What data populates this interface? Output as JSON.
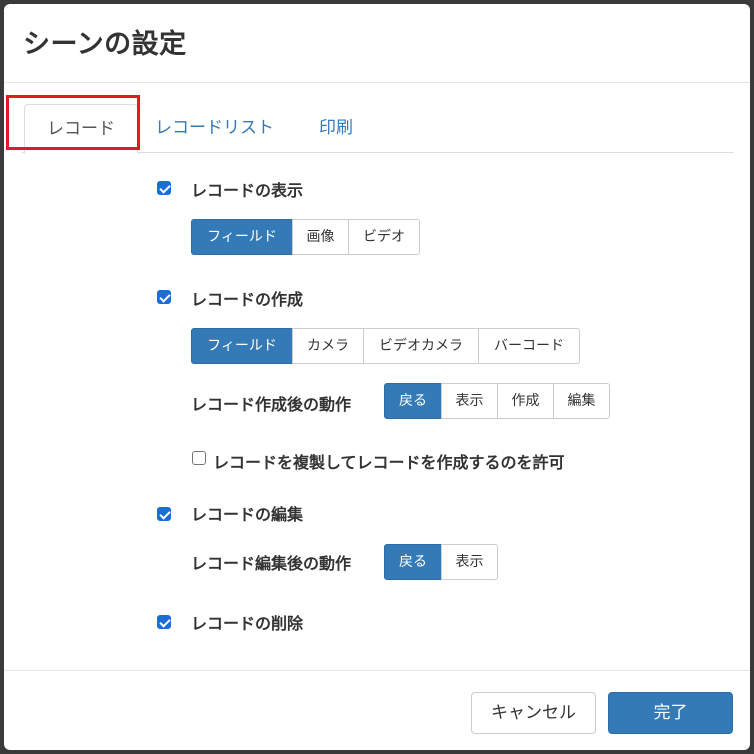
{
  "dialog": {
    "title": "シーンの設定"
  },
  "tabs": [
    {
      "label": "レコード",
      "active": true
    },
    {
      "label": "レコードリスト",
      "active": false
    },
    {
      "label": "印刷",
      "active": false
    }
  ],
  "record_display": {
    "checked": true,
    "label": "レコードの表示",
    "options": [
      "フィールド",
      "画像",
      "ビデオ"
    ],
    "selected": "フィールド"
  },
  "record_create": {
    "checked": true,
    "label": "レコードの作成",
    "options": [
      "フィールド",
      "カメラ",
      "ビデオカメラ",
      "バーコード"
    ],
    "selected": "フィールド",
    "after_action_label": "レコード作成後の動作",
    "after_action_options": [
      "戻る",
      "表示",
      "作成",
      "編集"
    ],
    "after_action_selected": "戻る",
    "duplicate_checked": false,
    "duplicate_label": "レコードを複製してレコードを作成するのを許可"
  },
  "record_edit": {
    "checked": true,
    "label": "レコードの編集",
    "after_action_label": "レコード編集後の動作",
    "after_action_options": [
      "戻る",
      "表示"
    ],
    "after_action_selected": "戻る"
  },
  "record_delete": {
    "checked": true,
    "label": "レコードの削除"
  },
  "footer": {
    "cancel_label": "キャンセル",
    "done_label": "完了"
  },
  "colors": {
    "primary": "#337ab7",
    "highlight": "#e8191e",
    "checkbox": "#1a6ed8"
  }
}
